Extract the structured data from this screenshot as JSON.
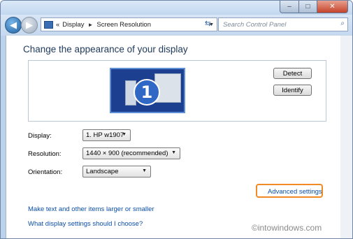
{
  "window": {
    "caption": {
      "minimize": "–",
      "maximize": "□",
      "close": "✕"
    }
  },
  "navbar": {
    "breadcrumb": {
      "prefix": "«",
      "items": [
        "Display",
        "Screen Resolution"
      ],
      "separator": "►",
      "dropdown": "▼"
    },
    "refresh_icon": "refresh-icon",
    "search_placeholder": "Search Control Panel"
  },
  "main": {
    "heading": "Change the appearance of your display",
    "monitor_number": "1",
    "detect_button": "Detect",
    "identify_button": "Identify",
    "fields": {
      "display": {
        "label": "Display:",
        "value": "1. HP w1907"
      },
      "resolution": {
        "label": "Resolution:",
        "value": "1440 × 900 (recommended)"
      },
      "orientation": {
        "label": "Orientation:",
        "value": "Landscape"
      }
    },
    "advanced_settings": "Advanced settings",
    "links": [
      "Make text and other items larger or smaller",
      "What display settings should I choose?"
    ]
  },
  "watermark": "©intowindows.com",
  "colors": {
    "highlight_ring": "#f08a24",
    "link": "#0a4ea8",
    "heading": "#1e395b"
  }
}
